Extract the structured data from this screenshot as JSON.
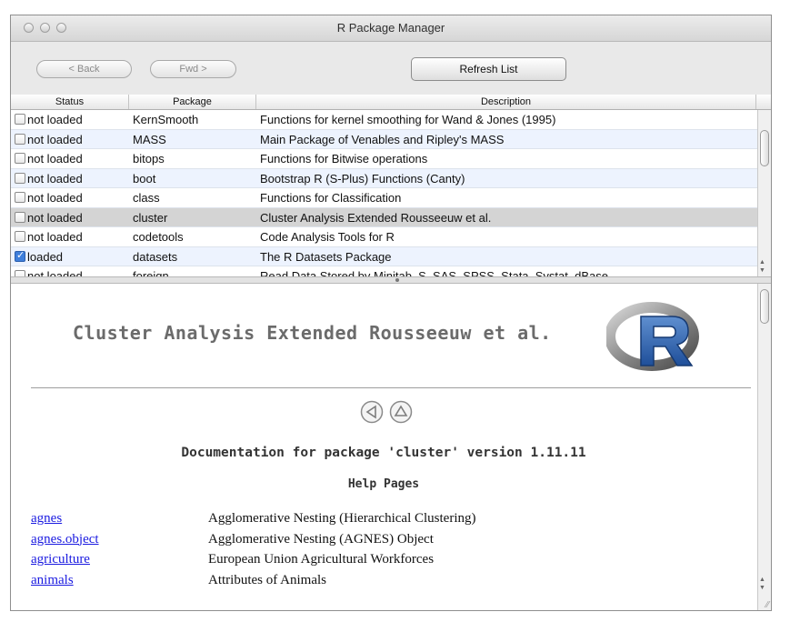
{
  "window": {
    "title": "R Package Manager"
  },
  "toolbar": {
    "back_label": "< Back",
    "fwd_label": "Fwd >",
    "refresh_label": "Refresh List"
  },
  "table": {
    "headers": {
      "status": "Status",
      "package": "Package",
      "description": "Description"
    },
    "rows": [
      {
        "checked": false,
        "status": "not loaded",
        "package": "KernSmooth",
        "description": "Functions for kernel smoothing for Wand & Jones (1995)"
      },
      {
        "checked": false,
        "status": "not loaded",
        "package": "MASS",
        "description": "Main Package of Venables and Ripley's MASS"
      },
      {
        "checked": false,
        "status": "not loaded",
        "package": "bitops",
        "description": "Functions for Bitwise operations"
      },
      {
        "checked": false,
        "status": "not loaded",
        "package": "boot",
        "description": "Bootstrap R (S-Plus) Functions (Canty)"
      },
      {
        "checked": false,
        "status": "not loaded",
        "package": "class",
        "description": "Functions for Classification"
      },
      {
        "checked": false,
        "status": "not loaded",
        "package": "cluster",
        "description": "Cluster Analysis Extended Rousseeuw et al.",
        "selected": true
      },
      {
        "checked": false,
        "status": "not loaded",
        "package": "codetools",
        "description": "Code Analysis Tools for R"
      },
      {
        "checked": true,
        "status": "loaded",
        "package": "datasets",
        "description": "The R Datasets Package"
      },
      {
        "checked": false,
        "status": "not loaded",
        "package": "foreign",
        "description": "Read Data Stored by Minitab, S, SAS, SPSS, Stata, Systat, dBase",
        "partial": true
      }
    ]
  },
  "help": {
    "package_title": "Cluster Analysis Extended Rousseeuw et al.",
    "doc_title": "Documentation for package 'cluster' version 1.11.11",
    "heading": "Help Pages",
    "entries": [
      {
        "link": "agnes",
        "desc": "Agglomerative Nesting (Hierarchical Clustering)"
      },
      {
        "link": "agnes.object",
        "desc": "Agglomerative Nesting (AGNES) Object"
      },
      {
        "link": "agriculture",
        "desc": "European Union Agricultural Workforces"
      },
      {
        "link": "animals",
        "desc": "Attributes of Animals"
      }
    ]
  },
  "colors": {
    "row_alt": "#edf3fe",
    "row_selected": "#d4d4d4",
    "link": "#1a1ae0",
    "checkbox_on": "#3f7fdb"
  },
  "icons": {
    "window_controls": [
      "close-light-icon",
      "minimize-light-icon",
      "zoom-light-icon"
    ],
    "logo": "r-logo-icon",
    "nav": [
      "back-arrow-icon",
      "up-arrow-icon"
    ]
  }
}
